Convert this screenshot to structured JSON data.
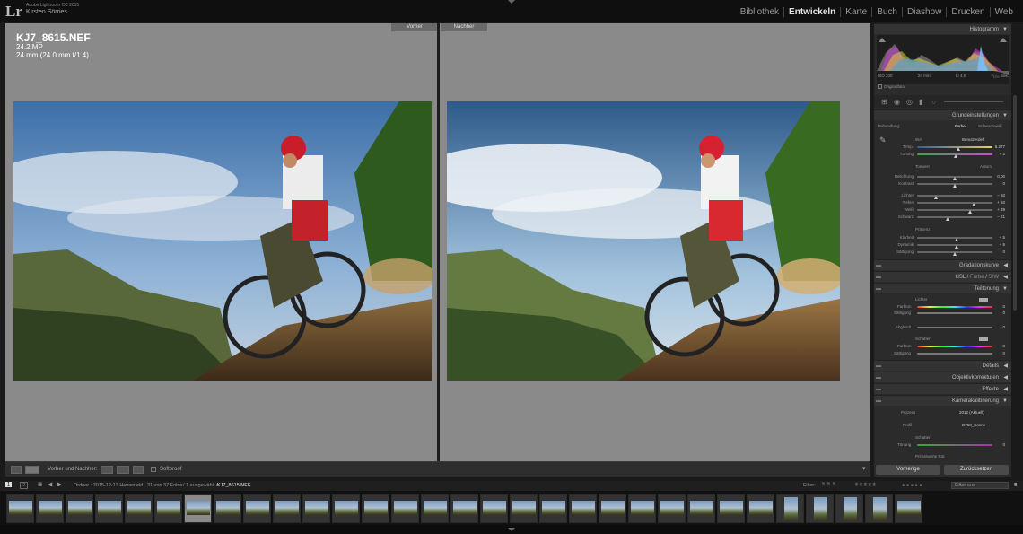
{
  "app": {
    "product": "Adobe Lightroom CC 2015",
    "user": "Kirsten Sörries",
    "logo": "Lr"
  },
  "modules": [
    "Bibliothek",
    "Entwickeln",
    "Karte",
    "Buch",
    "Diashow",
    "Drucken",
    "Web"
  ],
  "active_module": "Entwickeln",
  "view": {
    "before_label": "Vorher",
    "after_label": "Nachher",
    "filename": "KJ7_8615.NEF",
    "megapixels": "24.2 MP",
    "lens": "24 mm (24.0 mm f/1.4)"
  },
  "toolbar": {
    "before_after_label": "Vorher und Nachher:",
    "softproof_label": "Softproof"
  },
  "right_panel": {
    "histogram_title": "Histogramm",
    "histogram_info": {
      "iso": "ISO 200",
      "focal": "24 mm",
      "aperture": "f / 4,5",
      "shutter": "¹⁄₁₂₅₀ Sek."
    },
    "original_photo_label": "Originalfoto",
    "basic_title": "Grundeinstellungen",
    "treatment_label": "Behandlung:",
    "treatment_color": "Farbe",
    "treatment_bw": "Schwarzweiß",
    "wb_label": "WA:",
    "wb_value": "Benutzerdef.",
    "temp_label": "Temp.",
    "temp_value": "6.277",
    "tint_label": "Tönung",
    "tint_value": "+ 2",
    "tone_label": "Tonwert",
    "auto_label": "Autom.",
    "exposure_label": "Belichtung",
    "exposure_value": "0,00",
    "contrast_label": "Kontrast",
    "contrast_value": "0",
    "highlights_label": "Lichter",
    "highlights_value": "− 50",
    "shadows_label": "Tiefen",
    "shadows_value": "+ 50",
    "whites_label": "Weiß",
    "whites_value": "+ 39",
    "blacks_label": "Schwarz",
    "blacks_value": "− 21",
    "presence_label": "Präsenz",
    "clarity_label": "Klarheit",
    "clarity_value": "+ 5",
    "vibrance_label": "Dynamik",
    "vibrance_value": "+ 5",
    "saturation_label": "Sättigung",
    "saturation_value": "0",
    "tone_curve_title": "Gradationskurve",
    "hsl_title": "HSL",
    "hsl_color": "Farbe",
    "hsl_bw": "S/W",
    "split_title": "Teiltonung",
    "split_highlights": "Lichter",
    "split_hue": "Farbton",
    "split_sat": "Sättigung",
    "split_balance": "Abgleich",
    "split_shadows": "Schatten",
    "split_shadow_hue": "Farbton",
    "split_shadow_sat": "Sättigung",
    "zero": "0",
    "details_title": "Details",
    "lens_title": "Objektivkorrekturen",
    "effects_title": "Effekte",
    "calib_title": "Kamerakalibrierung",
    "process_label": "Prozess",
    "process_value": "2012 (Aktuell)",
    "profile_label": "Profil",
    "profile_value": "D750_Sonne",
    "shadows_section": "Schatten",
    "calib_tint": "Tönung",
    "primaries_label": "Primärwerte Rot",
    "prev_button": "Vorherige",
    "reset_button": "Zurücksetzen"
  },
  "filmstrip": {
    "page1": "1",
    "page2": "2",
    "path": "Ordner : 2015-12-12 Hewenfeld",
    "count": "31 von 37 Fotos",
    "selected": "/ 1 ausgewählt /",
    "file": "KJ7_8615.NEF",
    "filter_label": "Filter:",
    "filter_value": "Filter aus"
  }
}
